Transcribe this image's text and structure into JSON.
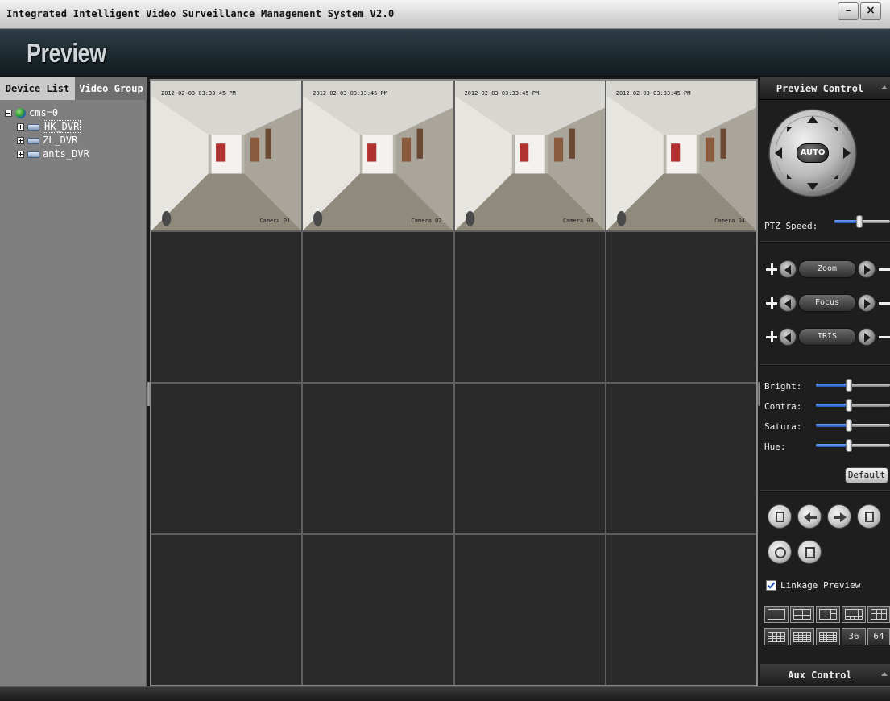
{
  "window": {
    "title": "Integrated Intelligent Video Surveillance Management System V2.0",
    "minimize_glyph": "–",
    "close_glyph": "×"
  },
  "header": {
    "page_title": "Preview"
  },
  "left_panel": {
    "tabs": [
      "Device List",
      "Video Group"
    ],
    "active_tab": "Device List",
    "tree": {
      "root": {
        "label": "cms=0",
        "icon": "globe-icon",
        "expanded": true
      },
      "children": [
        {
          "label": "HK_DVR",
          "icon": "dvr-icon",
          "selected": true
        },
        {
          "label": "ZL_DVR",
          "icon": "dvr-icon",
          "selected": false
        },
        {
          "label": "ants_DVR",
          "icon": "dvr-icon",
          "selected": false
        }
      ]
    }
  },
  "video_grid": {
    "layout": "4x4",
    "selected_cell": 1,
    "cameras": [
      {
        "timestamp": "2012-02-03 03:33:45 PM",
        "name": "Camera 01"
      },
      {
        "timestamp": "2012-02-03 03:33:45 PM",
        "name": "Camera 02"
      },
      {
        "timestamp": "2012-02-03 03:33:45 PM",
        "name": "Camera 03"
      },
      {
        "timestamp": "2012-02-03 03:33:45 PM",
        "name": "Camera 04"
      }
    ]
  },
  "preview_control": {
    "title": "Preview Control",
    "ptz": {
      "center_label": "AUTO"
    },
    "ptz_speed": {
      "label": "PTZ Speed:",
      "value": 0.45
    },
    "lens": [
      {
        "label": "Zoom"
      },
      {
        "label": "Focus"
      },
      {
        "label": "IRIS"
      }
    ],
    "image": [
      {
        "label": "Bright:",
        "value": 0.45
      },
      {
        "label": "Contra:",
        "value": 0.45
      },
      {
        "label": "Satura:",
        "value": 0.45
      },
      {
        "label": "Hue:",
        "value": 0.45
      }
    ],
    "default_button": "Default",
    "linkage_preview": {
      "label": "Linkage Preview",
      "checked": true
    },
    "layout_buttons": [
      "1",
      "4",
      "6",
      "8",
      "9",
      "13",
      "16",
      "36",
      "64"
    ],
    "layout_text_36": "36",
    "layout_text_64": "64"
  },
  "aux_control": {
    "title": "Aux Control"
  },
  "colors": {
    "selection_border": "#c4201c",
    "slider_fill": "#1e4fb8",
    "header_bg": "#1d2a30"
  }
}
